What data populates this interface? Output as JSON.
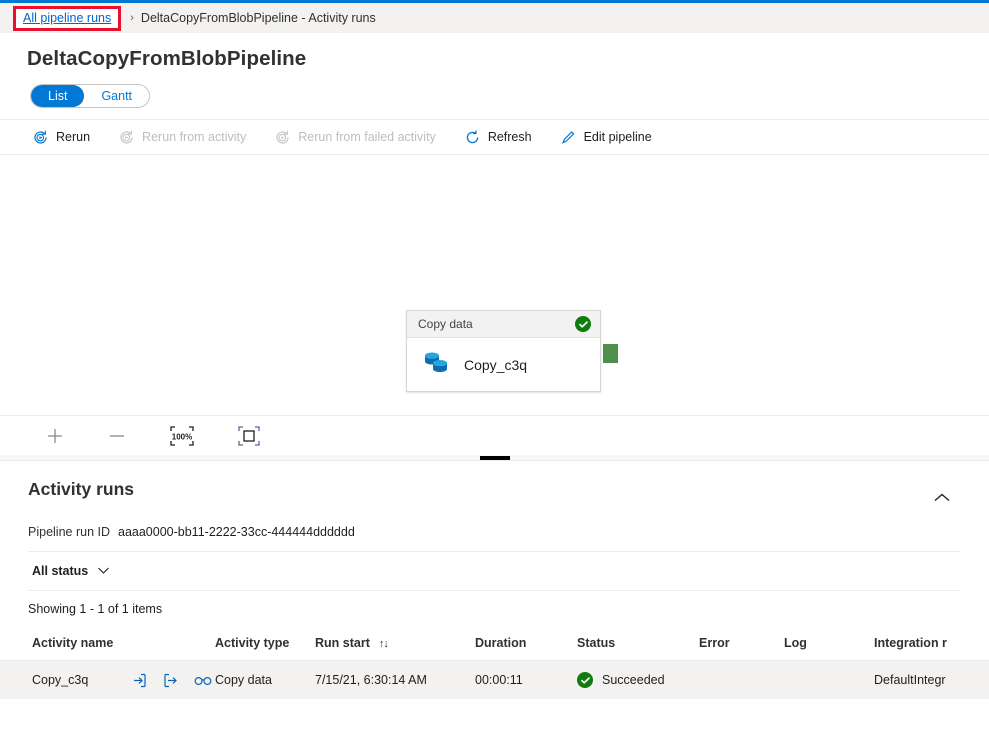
{
  "breadcrumb": {
    "link": "All pipeline runs",
    "separator": "›",
    "current": "DeltaCopyFromBlobPipeline - Activity runs"
  },
  "page_title": "DeltaCopyFromBlobPipeline",
  "view_toggle": {
    "list_label": "List",
    "gantt_label": "Gantt",
    "active": "List"
  },
  "command_bar": {
    "rerun": "Rerun",
    "rerun_from_activity": "Rerun from activity",
    "rerun_from_failed_activity": "Rerun from failed activity",
    "refresh": "Refresh",
    "edit_pipeline": "Edit pipeline"
  },
  "canvas": {
    "node": {
      "type_label": "Copy data",
      "name": "Copy_c3q",
      "status_icon": "success-check-icon"
    },
    "zoom_controls": {
      "zoom_in": "zoom-in-icon",
      "zoom_out": "zoom-out-icon",
      "zoom_reset_label": "100%",
      "fit_to_screen": "fit-to-screen-icon"
    }
  },
  "activity_runs": {
    "title": "Activity runs",
    "pipeline_run_id_label": "Pipeline run ID",
    "pipeline_run_id_value": "aaaa0000-bb11-2222-33cc-444444dddddd",
    "status_filter": "All status",
    "showing_text": "Showing 1 - 1 of 1 items",
    "columns": [
      "Activity name",
      "Activity type",
      "Run start",
      "Duration",
      "Status",
      "Error",
      "Log",
      "Integration r"
    ],
    "sort_column": "Run start",
    "rows": [
      {
        "activity_name": "Copy_c3q",
        "activity_type": "Copy data",
        "run_start": "7/15/21, 6:30:14 AM",
        "duration": "00:00:11",
        "status": "Succeeded",
        "error": "",
        "log": "",
        "integration_runtime": "DefaultIntegr"
      }
    ]
  },
  "colors": {
    "accent": "#0078d4",
    "success": "#107c10",
    "highlight": "#e8112d",
    "connector": "#4e8f4e"
  }
}
